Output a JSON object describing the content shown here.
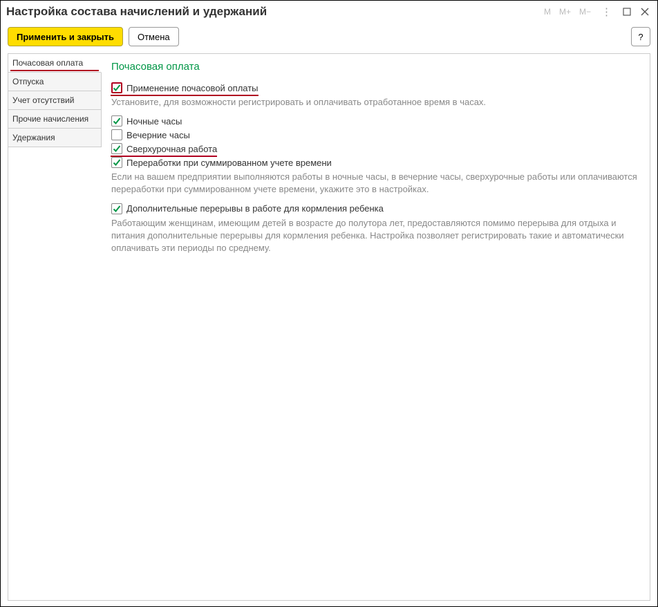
{
  "title": "Настройка состава начислений и удержаний",
  "toolbar": {
    "apply_close": "Применить и закрыть",
    "cancel": "Отмена",
    "help": "?"
  },
  "titlebar_calc": {
    "m": "M",
    "mp": "M+",
    "mm": "M−"
  },
  "sidebar": {
    "items": [
      {
        "label": "Почасовая оплата",
        "active": true,
        "underline": true
      },
      {
        "label": "Отпуска",
        "active": false
      },
      {
        "label": "Учет отсутствий",
        "active": false
      },
      {
        "label": "Прочие начисления",
        "active": false
      },
      {
        "label": "Удержания",
        "active": false
      }
    ]
  },
  "content": {
    "heading": "Почасовая оплата",
    "checkboxes": [
      {
        "label": "Применение почасовой оплаты",
        "checked": true,
        "hl_box": true,
        "underline_row": true
      },
      {
        "label": "Установите, для возможности регистрировать и оплачивать отработанное время в часах.",
        "is_desc": true
      },
      {
        "label": "Ночные часы",
        "checked": true
      },
      {
        "label": "Вечерние часы",
        "checked": false
      },
      {
        "label": "Сверхурочная работа",
        "checked": true,
        "underline_row": true
      },
      {
        "label": "Переработки при суммированном учете времени",
        "checked": true
      },
      {
        "label": "Если на вашем предприятии выполняются работы в ночные часы, в вечерние часы, сверхурочные работы или оплачиваются переработки при суммированном учете времени, укажите это в настройках.",
        "is_desc": true
      },
      {
        "label": "Дополнительные перерывы в работе для кормления ребенка",
        "checked": true
      },
      {
        "label": "Работающим женщинам, имеющим детей в возрасте до полутора лет, предоставляются помимо перерыва для отдыха и питания дополнительные перерывы для кормления ребенка. Настройка позволяет регистрировать такие и автоматически оплачивать эти периоды по среднему.",
        "is_desc": true
      }
    ]
  }
}
